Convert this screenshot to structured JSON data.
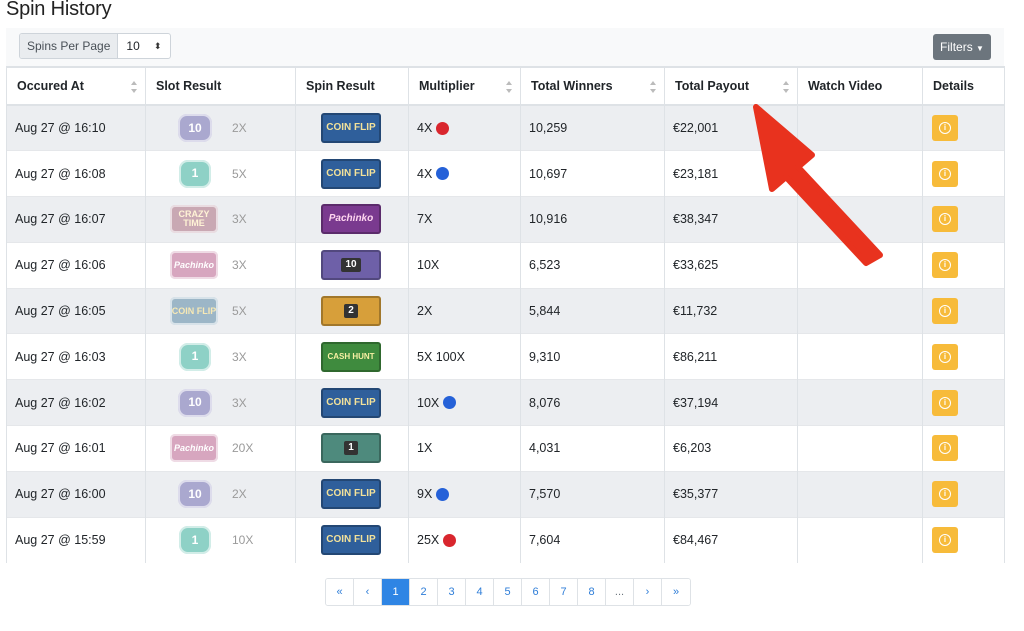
{
  "page": {
    "title": "Spin History"
  },
  "toolbar": {
    "spins_per_page_label": "Spins Per Page",
    "spins_per_page_value": "10",
    "filters_label": "Filters"
  },
  "table": {
    "headers": {
      "occured_at": "Occured At",
      "slot_result": "Slot Result",
      "spin_result": "Spin Result",
      "multiplier": "Multiplier",
      "total_winners": "Total Winners",
      "total_payout": "Total Payout",
      "watch_video": "Watch Video",
      "details": "Details"
    },
    "rows": [
      {
        "occured_at": "Aug 27 @ 16:10",
        "slot_icon_text": "10",
        "slot_mult": "2X",
        "spin_icon_text": "COIN FLIP",
        "multiplier": "4X",
        "dot": "red",
        "total_winners": "10,259",
        "total_payout": "€22,001"
      },
      {
        "occured_at": "Aug 27 @ 16:08",
        "slot_icon_text": "1",
        "slot_mult": "5X",
        "spin_icon_text": "COIN FLIP",
        "multiplier": "4X",
        "dot": "blue",
        "total_winners": "10,697",
        "total_payout": "€23,181"
      },
      {
        "occured_at": "Aug 27 @ 16:07",
        "slot_icon_text": "CRAZY TIME",
        "slot_mult": "3X",
        "spin_icon_text": "Pachinko",
        "multiplier": "7X",
        "dot": "",
        "total_winners": "10,916",
        "total_payout": "€38,347"
      },
      {
        "occured_at": "Aug 27 @ 16:06",
        "slot_icon_text": "Pachinko",
        "slot_mult": "3X",
        "spin_icon_text": "10",
        "multiplier": "10X",
        "dot": "",
        "total_winners": "6,523",
        "total_payout": "€33,625"
      },
      {
        "occured_at": "Aug 27 @ 16:05",
        "slot_icon_text": "COIN FLIP",
        "slot_mult": "5X",
        "spin_icon_text": "2",
        "multiplier": "2X",
        "dot": "",
        "total_winners": "5,844",
        "total_payout": "€11,732"
      },
      {
        "occured_at": "Aug 27 @ 16:03",
        "slot_icon_text": "1",
        "slot_mult": "3X",
        "spin_icon_text": "CASH HUNT",
        "multiplier": "5X 100X",
        "dot": "",
        "total_winners": "9,310",
        "total_payout": "€86,211"
      },
      {
        "occured_at": "Aug 27 @ 16:02",
        "slot_icon_text": "10",
        "slot_mult": "3X",
        "spin_icon_text": "COIN FLIP",
        "multiplier": "10X",
        "dot": "blue",
        "total_winners": "8,076",
        "total_payout": "€37,194"
      },
      {
        "occured_at": "Aug 27 @ 16:01",
        "slot_icon_text": "Pachinko",
        "slot_mult": "20X",
        "spin_icon_text": "1",
        "multiplier": "1X",
        "dot": "",
        "total_winners": "4,031",
        "total_payout": "€6,203"
      },
      {
        "occured_at": "Aug 27 @ 16:00",
        "slot_icon_text": "10",
        "slot_mult": "2X",
        "spin_icon_text": "COIN FLIP",
        "multiplier": "9X",
        "dot": "blue",
        "total_winners": "7,570",
        "total_payout": "€35,377"
      },
      {
        "occured_at": "Aug 27 @ 15:59",
        "slot_icon_text": "1",
        "slot_mult": "10X",
        "spin_icon_text": "COIN FLIP",
        "multiplier": "25X",
        "dot": "red",
        "total_winners": "7,604",
        "total_payout": "€84,467"
      }
    ]
  },
  "pagination": {
    "first": "«",
    "prev": "‹",
    "pages": [
      "1",
      "2",
      "3",
      "4",
      "5",
      "6",
      "7",
      "8"
    ],
    "active_page": "1",
    "ellipsis": "...",
    "next": "›",
    "last": "»"
  },
  "colors": {
    "details_button": "#f7bb3a",
    "active_page": "#2f85e4",
    "annotation_arrow": "#e8321e",
    "dot_red": "#d9262e",
    "dot_blue": "#2561d8"
  }
}
